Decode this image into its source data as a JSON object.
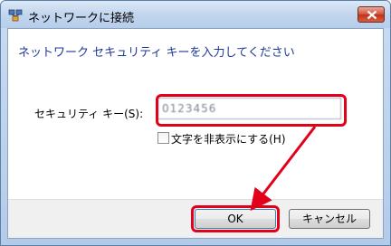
{
  "window": {
    "title": "ネットワークに接続"
  },
  "dialog": {
    "heading": "ネットワーク セキュリティ キーを入力してください",
    "key_label": "セキュリティ キー(S):",
    "key_value": "0123456",
    "hide_chars_label": "文字を非表示にする(H)",
    "hide_chars_checked": false
  },
  "buttons": {
    "ok_label": "OK",
    "cancel_label": "キャンセル"
  },
  "colors": {
    "heading": "#1e3a96",
    "highlight": "#e2001a"
  }
}
